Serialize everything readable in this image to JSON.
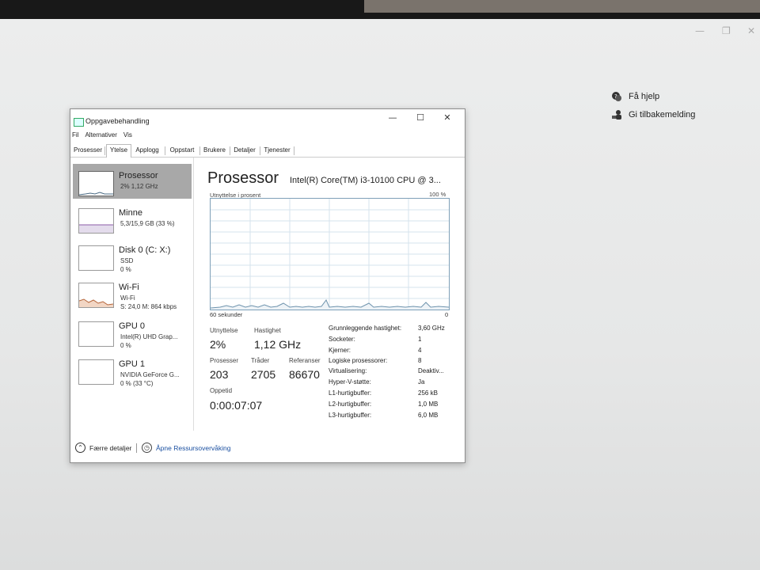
{
  "desktop": {
    "help_links": [
      {
        "label": "Få hjelp",
        "icon": "help-chat-icon"
      },
      {
        "label": "Gi tilbakemelding",
        "icon": "feedback-person-icon"
      }
    ]
  },
  "window": {
    "title": "Oppgavebehandling",
    "controls": {
      "minimize": "—",
      "maximize": "☐",
      "close": "✕"
    }
  },
  "menu": [
    "Fil",
    "Alternativer",
    "Vis"
  ],
  "tabs": [
    "Prosesser",
    "Ytelse",
    "Applogg",
    "Oppstart",
    "Brukere",
    "Detaljer",
    "Tjenester"
  ],
  "active_tab": "Ytelse",
  "resources": [
    {
      "title": "Prosessor",
      "sub1": "2% 1,12 GHz",
      "sub2": ""
    },
    {
      "title": "Minne",
      "sub1": "5,3/15,9 GB (33 %)",
      "sub2": ""
    },
    {
      "title": "Disk 0 (C: X:)",
      "sub1": "SSD",
      "sub2": "0 %"
    },
    {
      "title": "Wi-Fi",
      "sub1": "Wi-Fi",
      "sub2": "S: 24,0 M: 864 kbps"
    },
    {
      "title": "GPU 0",
      "sub1": "Intel(R) UHD Grap...",
      "sub2": "0 %"
    },
    {
      "title": "GPU 1",
      "sub1": "NVIDIA GeForce G...",
      "sub2": "0 % (33 °C)"
    }
  ],
  "detail": {
    "title": "Prosessor",
    "cpu_name": "Intel(R) Core(TM) i3-10100 CPU @ 3...",
    "graph_label": "Utnyttelse i prosent",
    "graph_max": "100 %",
    "graph_time": "60 sekunder",
    "graph_min": "0",
    "stats": {
      "utilization_label": "Utnyttelse",
      "utilization_value": "2%",
      "speed_label": "Hastighet",
      "speed_value": "1,12 GHz",
      "processes_label": "Prosesser",
      "processes_value": "203",
      "threads_label": "Tråder",
      "threads_value": "2705",
      "handles_label": "Referanser",
      "handles_value": "86670",
      "uptime_label": "Oppetid",
      "uptime_value": "0:00:07:07"
    },
    "specs": [
      {
        "key": "Grunnleggende hastighet:",
        "value": "3,60 GHz"
      },
      {
        "key": "Socketer:",
        "value": "1"
      },
      {
        "key": "Kjerner:",
        "value": "4"
      },
      {
        "key": "Logiske prosessorer:",
        "value": "8"
      },
      {
        "key": "Virtualisering:",
        "value": "Deaktiv..."
      },
      {
        "key": "Hyper-V-støtte:",
        "value": "Ja"
      },
      {
        "key": "L1-hurtigbuffer:",
        "value": "256 kB"
      },
      {
        "key": "L2-hurtigbuffer:",
        "value": "1,0 MB"
      },
      {
        "key": "L3-hurtigbuffer:",
        "value": "6,0 MB"
      }
    ]
  },
  "footer": {
    "fewer_details": "Færre detaljer",
    "open_monitor": "Åpne Ressursovervåking"
  },
  "colors": {
    "graph_line": "#6e93ad",
    "graph_grid": "#d6e3ec",
    "active_item": "#a8a8a8"
  }
}
